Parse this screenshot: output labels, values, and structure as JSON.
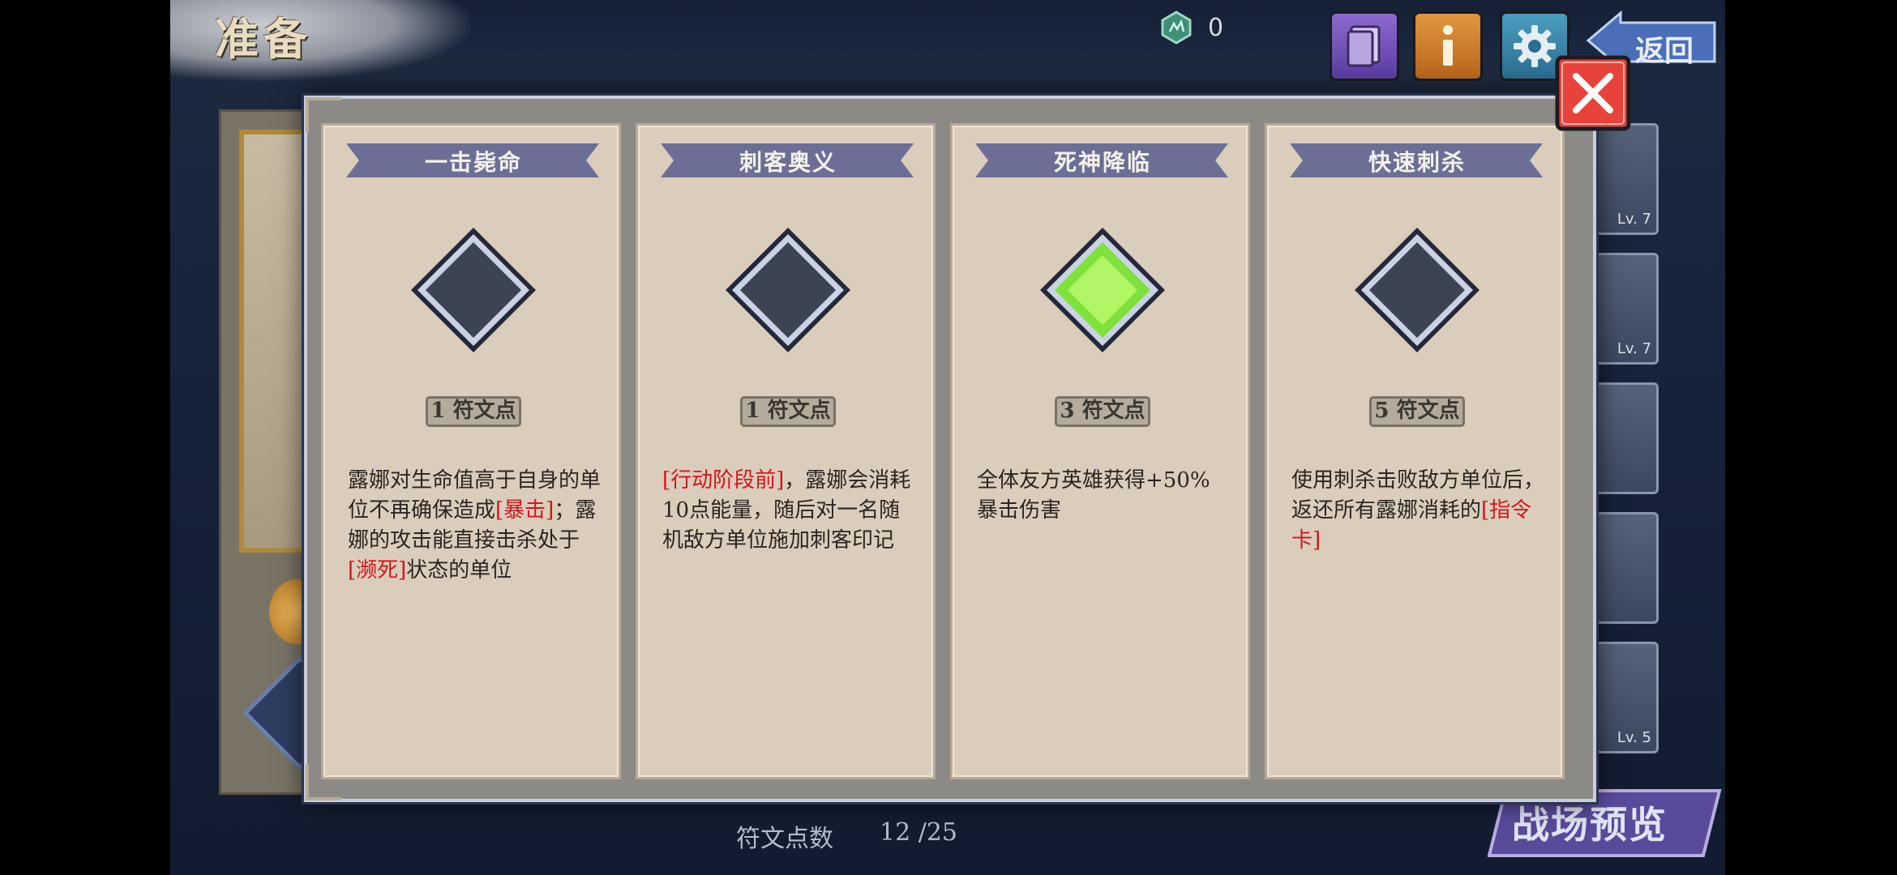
{
  "header": {
    "title": "准备",
    "currency_value": "0"
  },
  "toolbar": {
    "back_label": "返回"
  },
  "side_slots": [
    {
      "level": "Lv. 7"
    },
    {
      "level": "Lv. 7"
    },
    {
      "level": ""
    },
    {
      "level": ""
    },
    {
      "level": "Lv. 5"
    }
  ],
  "footer": {
    "points_label": "符文点数",
    "points_value": "12 /25",
    "preview_label": "战场预览"
  },
  "dialog": {
    "cards": [
      {
        "title": "一击毙命",
        "cost": "1 符文点",
        "selected": false,
        "desc": [
          {
            "t": "露娜对生命值高于自身的单位不再确保造成",
            "hl": false
          },
          {
            "t": "[暴击]",
            "hl": true
          },
          {
            "t": "；露娜的攻击能直接击杀处于",
            "hl": false
          },
          {
            "t": "[濒死]",
            "hl": true
          },
          {
            "t": "状态的单位",
            "hl": false
          }
        ]
      },
      {
        "title": "刺客奥义",
        "cost": "1 符文点",
        "selected": false,
        "desc": [
          {
            "t": "[行动阶段前]",
            "hl": true
          },
          {
            "t": "，露娜会消耗10点能量，随后对一名随机敌方单位施加刺客印记",
            "hl": false
          }
        ]
      },
      {
        "title": "死神降临",
        "cost": "3 符文点",
        "selected": true,
        "desc": [
          {
            "t": "全体友方英雄获得+50%暴击伤害",
            "hl": false
          }
        ]
      },
      {
        "title": "快速刺杀",
        "cost": "5 符文点",
        "selected": false,
        "desc": [
          {
            "t": "使用刺杀击败敌方单位后，返还所有露娜消耗的",
            "hl": false
          },
          {
            "t": "[指令卡]",
            "hl": true
          }
        ]
      }
    ]
  },
  "colors": {
    "highlight": "#d8141a",
    "rune_selected": "#7ee23a",
    "rune_empty": "#3c4352",
    "banner": "#6c6f95"
  }
}
